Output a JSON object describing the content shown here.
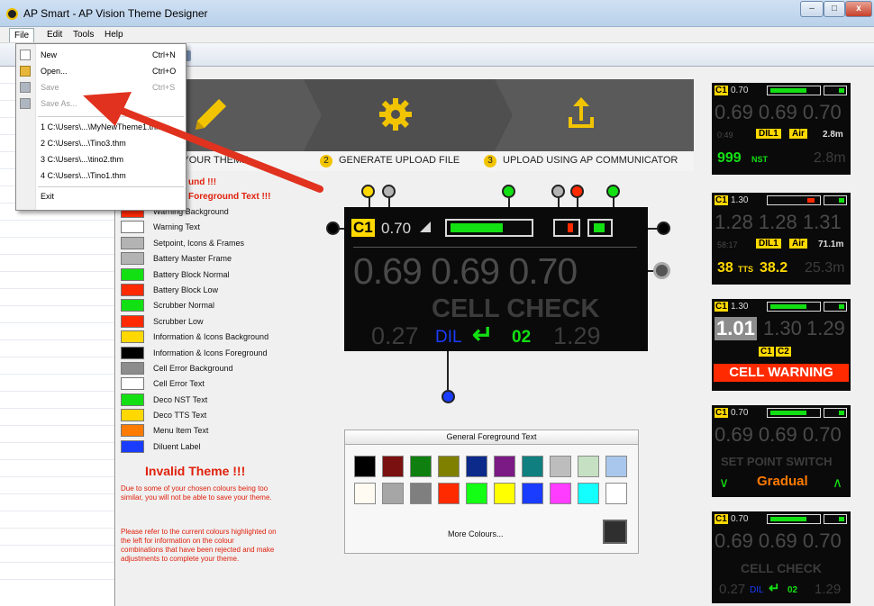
{
  "window": {
    "title": "AP Smart - AP Vision Theme Designer",
    "min": "–",
    "max": "□",
    "close": "x"
  },
  "menubar": {
    "items": [
      "File",
      "Edit",
      "Tools",
      "Help"
    ]
  },
  "file_menu": {
    "new": {
      "label": "New",
      "shortcut": "Ctrl+N"
    },
    "open": {
      "label": "Open...",
      "shortcut": "Ctrl+O"
    },
    "save": {
      "label": "Save",
      "shortcut": "Ctrl+S"
    },
    "save_as": {
      "label": "Save As..."
    },
    "recent": [
      "1 C:\\Users\\...\\MyNewTheme1.thm",
      "2 C:\\Users\\...\\Tino3.thm",
      "3 C:\\Users\\...\\tino2.thm",
      "4 C:\\Users\\...\\Tino1.thm"
    ],
    "exit": "Exit"
  },
  "steps": [
    {
      "num": "2",
      "label": "GENERATE UPLOAD FILE"
    },
    {
      "num": "3",
      "label": "UPLOAD USING AP COMMUNICATOR"
    }
  ],
  "step1_partial": "GN YOUR THEME",
  "warning_head": [
    "und !!!",
    "Foreground Text !!!"
  ],
  "legend": [
    {
      "label": "Warning Background",
      "color": "#ff2a00"
    },
    {
      "label": "Warning Text",
      "color": "#ffffff"
    },
    {
      "label": "Setpoint, Icons & Frames",
      "color": "#b3b3b3"
    },
    {
      "label": "Battery Master Frame",
      "color": "#b3b3b3"
    },
    {
      "label": "Battery Block Normal",
      "color": "#13e013"
    },
    {
      "label": "Battery Block Low",
      "color": "#ff2a00"
    },
    {
      "label": "Scrubber Normal",
      "color": "#13e013"
    },
    {
      "label": "Scrubber Low",
      "color": "#ff2a00"
    },
    {
      "label": "Information & Icons Background",
      "color": "#ffd800"
    },
    {
      "label": "Information & Icons Foreground",
      "color": "#000000"
    },
    {
      "label": "Cell Error Background",
      "color": "#8c8c8c"
    },
    {
      "label": "Cell Error Text",
      "color": "#ffffff"
    },
    {
      "label": "Deco NST Text",
      "color": "#13e013"
    },
    {
      "label": "Deco TTS Text",
      "color": "#ffd800"
    },
    {
      "label": "Menu Item Text",
      "color": "#ff7a00"
    },
    {
      "label": "Diluent Label",
      "color": "#1a3cff"
    }
  ],
  "invalid": {
    "title": "Invalid Theme !!!",
    "para1": "Due to some of your chosen colours being too similar, you will not be able to save your theme.",
    "para2": "Please refer to the current colours highlighted on the left for information on the colour combinations that have been rejected and make adjustments to complete your theme."
  },
  "preview": {
    "cell_tag": "C1",
    "setpoint": "0.70",
    "readings": [
      "0.69",
      "0.69",
      "0.70"
    ],
    "mode": "CELL CHECK",
    "dil": "DIL",
    "left_val": "0.27",
    "cyl": "02",
    "right_val": "1.29",
    "enter_glyph": "↵"
  },
  "picker": {
    "title": "General Foreground Text",
    "row1": [
      "#000000",
      "#7a1010",
      "#0f800f",
      "#808000",
      "#0b2a8a",
      "#7b1a84",
      "#0f7f80",
      "#bdbdbd",
      "#c6e0c3",
      "#a9c7ec"
    ],
    "row2": [
      "#fffbf2",
      "#a6a6a6",
      "#7f7f7f",
      "#ff2a00",
      "#13ff13",
      "#ffff00",
      "#1a3cff",
      "#ff3cff",
      "#13ffff",
      "#ffffff"
    ],
    "more": "More Colours...",
    "current": "#2f2f2f"
  },
  "thumbs": [
    {
      "tag": "C1",
      "sp": "0.70",
      "r": "0.69 0.69 0.70",
      "time": "0:49",
      "dil": "DIL1",
      "gas": "Air",
      "depth": "2.8m",
      "nst": "999",
      "nst_label": "NST",
      "depth2": "2.8m"
    },
    {
      "tag": "C1",
      "sp": "1.30",
      "r": "1.28 1.28 1.31",
      "time": "58:17",
      "dil": "DIL1",
      "gas": "Air",
      "depth": "71.1m",
      "tts": "38",
      "tts_label": "TTS",
      "val": "38.2",
      "depth2": "25.3m"
    },
    {
      "tag": "C1",
      "sp": "1.30",
      "r1": "1.01",
      "r2": "1.30",
      "r3": "1.29",
      "c1": "C1",
      "c2": "C2",
      "warn": "CELL WARNING"
    },
    {
      "tag": "C1",
      "sp": "0.70",
      "r": "0.69 0.69 0.70",
      "mode": "SET POINT SWITCH",
      "sw": "Gradual",
      "down": "∨",
      "up": "∧"
    },
    {
      "tag": "C1",
      "sp": "0.70",
      "r": "0.69 0.69 0.70",
      "mode": "CELL CHECK",
      "dil": "DIL",
      "l": "0.27",
      "cyl": "02",
      "rv": "1.29",
      "enter_glyph": "↵"
    }
  ]
}
